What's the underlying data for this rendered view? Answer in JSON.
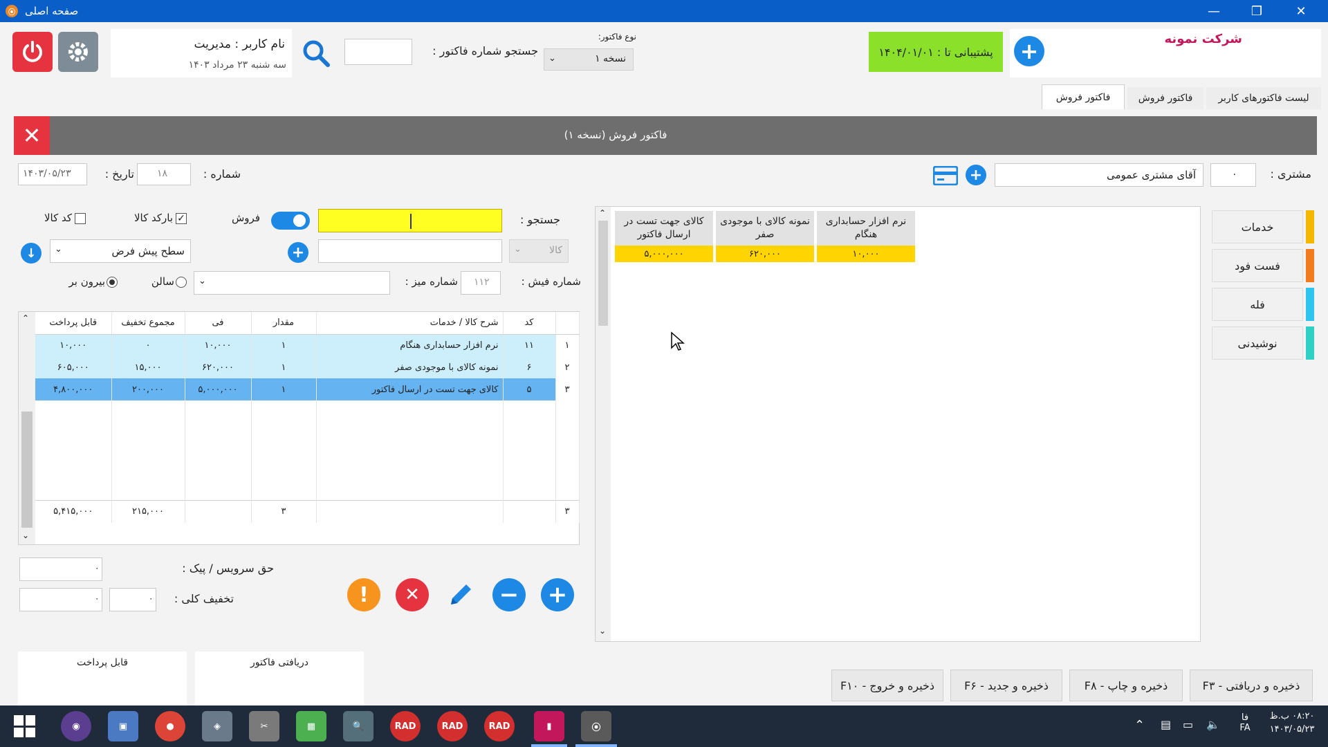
{
  "window": {
    "title": "صفحه اصلی"
  },
  "header": {
    "company": "شرکت نمونه",
    "support": "پشتیبانی تا : ۱۴۰۴/۰۱/۰۱",
    "invoice_type_label": "نوع فاکتور:",
    "invoice_type_value": "نسخه ۱",
    "search_invoice_label": "جستجو شماره فاکتور :",
    "user_label": "نام کاربر : مدیریت",
    "date_label": "سه شنبه ۲۳ مرداد ۱۴۰۳"
  },
  "tabs": [
    "لیست فاکتورهای کاربر",
    "فاکتور فروش",
    "فاکتور فروش"
  ],
  "form": {
    "title": "فاکتور فروش (نسخه ۱)",
    "customer_label": "مشتری :",
    "customer_code": "۰",
    "customer_name": "آقای مشتری عمومی",
    "number_label": "شماره :",
    "number_value": "۱۸",
    "date_label": "تاریخ :",
    "date_value": "۱۴۰۳/۰۵/۲۳",
    "search_label": "جستجو :",
    "sale_label": "فروش",
    "barcode_label": "بارکد کالا",
    "code_label": "کد کالا",
    "kala_label": "کالا",
    "price_level": "سطح پیش فرض",
    "receipt_label": "شماره فیش :",
    "receipt_value": "۱۱۲",
    "table_label": "شماره میز :",
    "hall_label": "سالن",
    "takeout_label": "بیرون بر",
    "service_label": "حق سرویس / پیک :",
    "service_value": "۰",
    "discount_label": "تخفیف کلی :",
    "discount_pct": "۰",
    "discount_value": "۰"
  },
  "grid": {
    "headers": [
      "کد",
      "شرح کالا / خدمات",
      "مقدار",
      "فی",
      "مجموع تخفیف",
      "قابل پرداخت"
    ],
    "rows": [
      {
        "idx": "۱",
        "code": "۱۱",
        "desc": "نرم افزار حسابداری هنگام",
        "qty": "۱",
        "price": "۱۰,۰۰۰",
        "disc": "۰",
        "pay": "۱۰,۰۰۰"
      },
      {
        "idx": "۲",
        "code": "۶",
        "desc": "نمونه کالای با موجودی صفر",
        "qty": "۱",
        "price": "۶۲۰,۰۰۰",
        "disc": "۱۵,۰۰۰",
        "pay": "۶۰۵,۰۰۰"
      },
      {
        "idx": "۳",
        "code": "۵",
        "desc": "کالای جهت تست در ارسال فاکتور",
        "qty": "۱",
        "price": "۵,۰۰۰,۰۰۰",
        "disc": "۲۰۰,۰۰۰",
        "pay": "۴,۸۰۰,۰۰۰"
      }
    ],
    "footer": {
      "count": "۳",
      "qty": "۳",
      "disc": "۲۱۵,۰۰۰",
      "pay": "۵,۴۱۵,۰۰۰"
    }
  },
  "products": [
    {
      "name": "نرم افزار حسابداری هنگام",
      "price": "۱۰,۰۰۰"
    },
    {
      "name": "نمونه کالای با موجودی صفر",
      "price": "۶۲۰,۰۰۰"
    },
    {
      "name": "کالای جهت تست در ارسال فاکتور",
      "price": "۵,۰۰۰,۰۰۰"
    }
  ],
  "categories": [
    {
      "label": "خدمات",
      "color": "#f5b800"
    },
    {
      "label": "فست فود",
      "color": "#f47a1f"
    },
    {
      "label": "فله",
      "color": "#2ec4f0"
    },
    {
      "label": "نوشیدنی",
      "color": "#2ed1c4"
    }
  ],
  "summary": {
    "received": "دریافتی فاکتور",
    "payable": "قابل پرداخت"
  },
  "fkeys": [
    "ذخیره و دریافتی - F۳",
    "ذخیره و چاپ - F۸",
    "ذخیره و جدید - F۶",
    "ذخیره و خروج - F۱۰"
  ],
  "taskbar": {
    "items": [
      "start",
      "github",
      "app",
      "chrome",
      "app2",
      "tools",
      "app3",
      "sql",
      "RAD",
      "RAD",
      "RAD",
      "app4",
      "app5"
    ],
    "time": "۰۸:۲۰ ب.ظ",
    "date": "۱۴۰۳/۰۵/۲۳",
    "lang_top": "فا",
    "lang_bottom": "FA"
  },
  "colors": {
    "titlebar": "#0a5ec8",
    "support": "#8be12a",
    "search_field": "#ffff22",
    "selected_row": "#66b3f2",
    "row_bg": "#cdeffc",
    "accent_blue": "#1e88e5"
  }
}
